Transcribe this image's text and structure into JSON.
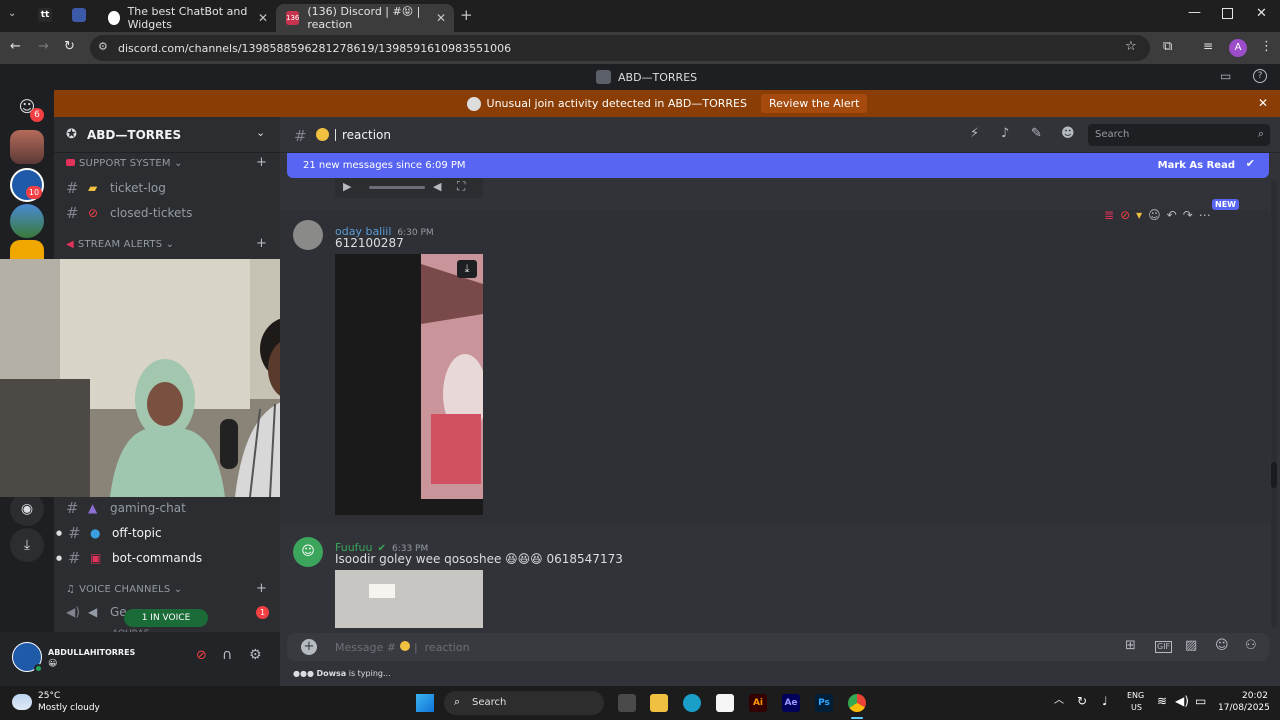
{
  "browser": {
    "tabs": [
      {
        "title": "The best ChatBot and Widgets"
      },
      {
        "title": "(136) Discord | #😝 | reaction"
      }
    ],
    "url": "discord.com/channels/1398588596281278619/1398591610983551006",
    "profile_initial": "A"
  },
  "discord": {
    "window_title": "ABD—TORRES",
    "alert": {
      "text": "Unusual join activity detected in ABD—TORRES",
      "button": "Review the Alert"
    },
    "server_badges": {
      "home": "6",
      "second": "10"
    },
    "server": {
      "name": "ABD—TORRES"
    },
    "categories": {
      "support": "SUPPORT SYSTEM",
      "stream": "STREAM ALERTS",
      "voice": "VOICE CHANNELS"
    },
    "channels": {
      "ticket_log": "ticket-log",
      "closed_tickets": "closed-tickets",
      "gaming_chat": "gaming-chat",
      "off_topic": "off-topic",
      "bot_commands": "bot-commands"
    },
    "voice": {
      "channel_partial": "Ge",
      "in_voice": "1 IN VOICE",
      "badge": "1",
      "sub_partial": "AOURAE"
    },
    "user": {
      "name": "ABDULLAHITORRES",
      "status": "😀"
    },
    "header": {
      "channel": "reaction",
      "search_placeholder": "Search"
    },
    "newbar": {
      "text": "21 new messages since 6:09 PM",
      "mark": "Mark As Read"
    },
    "messages": [
      {
        "author": "oday baliil",
        "time": "6:30 PM",
        "text": "612100287",
        "author_color": "#5b9bd5"
      },
      {
        "author": "Fuufuu",
        "time": "6:33 PM",
        "text": "Isoodir goley wee qososhee 😆😆😆 0618547173",
        "author_color": "#3ba55c"
      }
    ],
    "new_badge": "NEW",
    "composer": {
      "placeholder_prefix": "Message #",
      "placeholder_channel": "reaction"
    },
    "typing": {
      "user": "Dowsa",
      "suffix": " is typing..."
    }
  },
  "taskbar": {
    "weather": {
      "temp": "25°C",
      "desc": "Mostly cloudy"
    },
    "search": "Search",
    "lang": {
      "top": "ENG",
      "bottom": "US"
    },
    "clock": {
      "time": "20:02",
      "date": "17/08/2025"
    }
  },
  "colors": {
    "accent": "#5865f2",
    "alert": "#8a3d05",
    "online": "#23a55a"
  }
}
